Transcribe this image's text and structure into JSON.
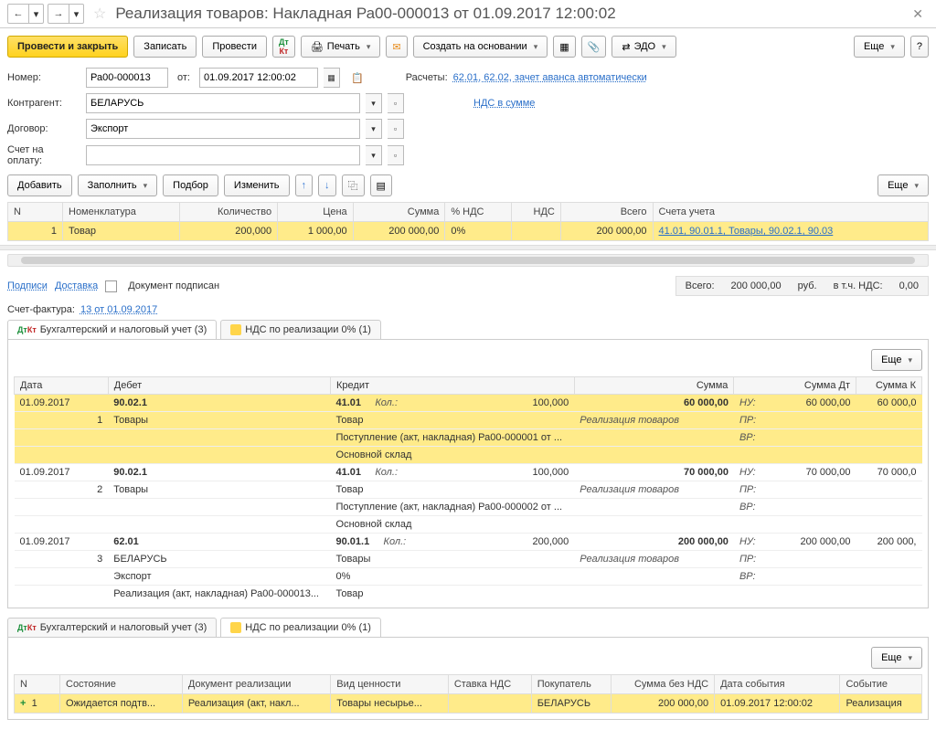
{
  "header": {
    "title": "Реализация товаров: Накладная Ра00-000013 от 01.09.2017 12:00:02"
  },
  "toolbar": {
    "post_close": "Провести и закрыть",
    "write": "Записать",
    "post": "Провести",
    "print": "Печать",
    "create_based": "Создать на основании",
    "edo": "ЭДО",
    "more": "Еще"
  },
  "form": {
    "number_lbl": "Номер:",
    "number": "Ра00-000013",
    "from_lbl": "от:",
    "date": "01.09.2017 12:00:02",
    "calc_lbl": "Расчеты:",
    "calc_link": "62.01, 62.02, зачет аванса автоматически",
    "contragent_lbl": "Контрагент:",
    "contragent": "БЕЛАРУСЬ",
    "nds_link": "НДС в сумме",
    "contract_lbl": "Договор:",
    "contract": "Экспорт",
    "account_lbl": "Счет на оплату:"
  },
  "items_toolbar": {
    "add": "Добавить",
    "fill": "Заполнить",
    "select": "Подбор",
    "edit": "Изменить",
    "more": "Еще"
  },
  "items_table": {
    "headers": {
      "n": "N",
      "nomen": "Номенклатура",
      "qty": "Количество",
      "price": "Цена",
      "sum": "Сумма",
      "vat_pct": "% НДС",
      "vat": "НДС",
      "total": "Всего",
      "accounts": "Счета учета"
    },
    "row": {
      "n": "1",
      "nomen": "Товар",
      "qty": "200,000",
      "price": "1 000,00",
      "sum": "200 000,00",
      "vat_pct": "0%",
      "vat": "",
      "total": "200 000,00",
      "accounts": "41.01, 90.01.1, Товары, 90.02.1, 90.03"
    }
  },
  "under_items": {
    "signs": "Подписи",
    "delivery": "Доставка",
    "signed": "Документ подписан",
    "total_lbl": "Всего:",
    "total": "200 000,00",
    "cur": "руб.",
    "vat_lbl": "в т.ч. НДС:",
    "vat": "0,00",
    "invoice_lbl": "Счет-фактура:",
    "invoice_link": "13 от 01.09.2017"
  },
  "tabs": {
    "t1": "Бухгалтерский и налоговый учет (3)",
    "t2": "НДС по реализации 0% (1)"
  },
  "postings": {
    "headers": {
      "date": "Дата",
      "debit": "Дебет",
      "credit": "Кредит",
      "sum": "Сумма",
      "sum_dt": "Сумма Дт",
      "sum_kt": "Сумма К"
    },
    "labels": {
      "qty": "Кол.:",
      "nu": "НУ:",
      "pr": "ПР:",
      "vr": "ВР:"
    },
    "rows": [
      {
        "date": "01.09.2017",
        "n": "1",
        "debit_acc": "90.02.1",
        "debit_l1": "Товары",
        "credit_acc": "41.01",
        "credit_qty": "100,000",
        "credit_l1": "Товар",
        "credit_l2": "Поступление (акт, накладная) Ра00-000001 от ...",
        "credit_l3": "Основной склад",
        "sum": "60 000,00",
        "sum_note": "Реализация товаров",
        "sum_dt": "60 000,00",
        "sum_kt": "60 000,0"
      },
      {
        "date": "01.09.2017",
        "n": "2",
        "debit_acc": "90.02.1",
        "debit_l1": "Товары",
        "credit_acc": "41.01",
        "credit_qty": "100,000",
        "credit_l1": "Товар",
        "credit_l2": "Поступление (акт, накладная) Ра00-000002 от ...",
        "credit_l3": "Основной склад",
        "sum": "70 000,00",
        "sum_note": "Реализация товаров",
        "sum_dt": "70 000,00",
        "sum_kt": "70 000,0"
      },
      {
        "date": "01.09.2017",
        "n": "3",
        "debit_acc": "62.01",
        "debit_l1": "БЕЛАРУСЬ",
        "debit_l2": "Экспорт",
        "debit_l3": "Реализация (акт, накладная) Ра00-000013...",
        "credit_acc": "90.01.1",
        "credit_qty": "200,000",
        "credit_l1": "Товары",
        "credit_l2": "0%",
        "credit_l3": "Товар",
        "sum": "200 000,00",
        "sum_note": "Реализация товаров",
        "sum_dt": "200 000,00",
        "sum_kt": "200 000,"
      }
    ]
  },
  "vat_table": {
    "headers": {
      "n": "N",
      "state": "Состояние",
      "doc": "Документ реализации",
      "kind": "Вид ценности",
      "rate": "Ставка НДС",
      "buyer": "Покупатель",
      "sum_no_vat": "Сумма без НДС",
      "event_date": "Дата события",
      "event": "Событие"
    },
    "row": {
      "n": "1",
      "state": "Ожидается подтв...",
      "doc": "Реализация (акт, накл...",
      "kind": "Товары несырье...",
      "rate": "",
      "buyer": "БЕЛАРУСЬ",
      "sum_no_vat": "200 000,00",
      "event_date": "01.09.2017 12:00:02",
      "event": "Реализация"
    }
  },
  "more": "Еще"
}
